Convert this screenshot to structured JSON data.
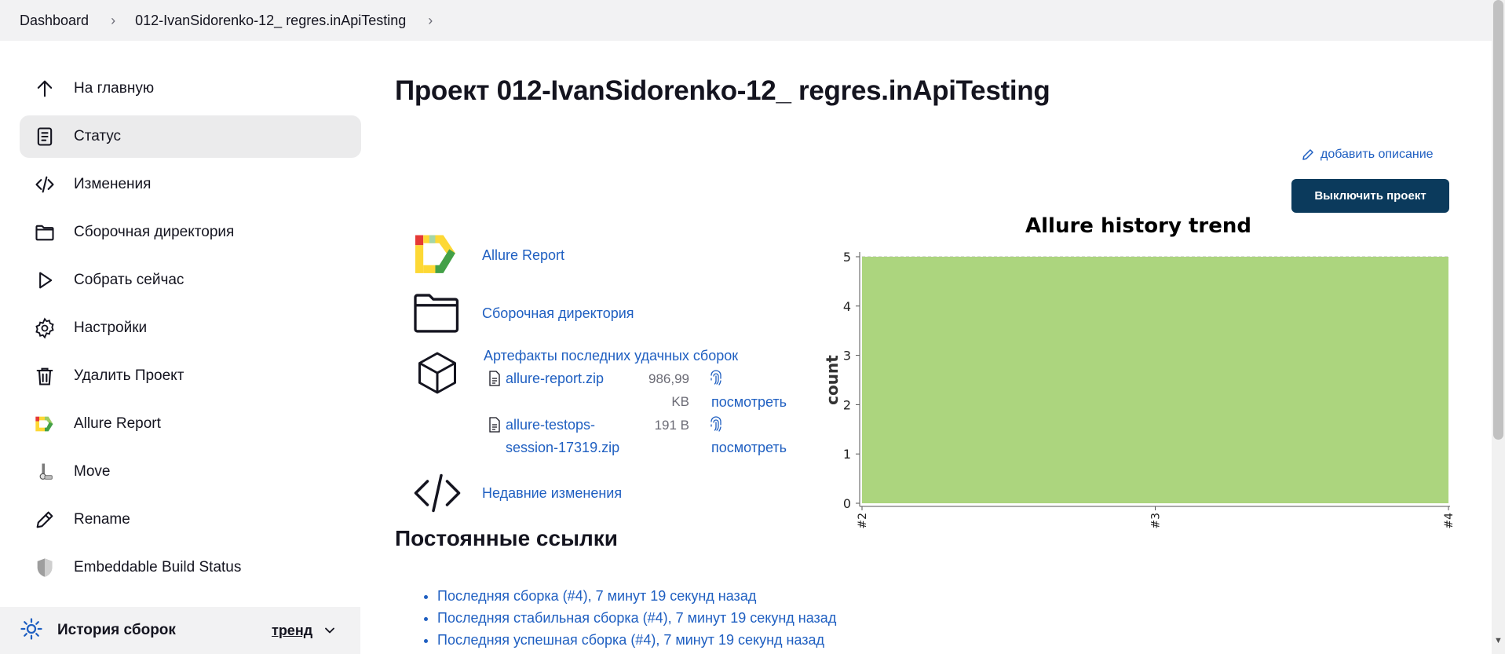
{
  "breadcrumb": {
    "items": [
      "Dashboard",
      "012-IvanSidorenko-12_ regres.inApiTesting"
    ]
  },
  "sidebar": {
    "items": [
      {
        "label": "На главную",
        "icon": "arrow-up-icon"
      },
      {
        "label": "Статус",
        "icon": "document-icon",
        "active": true
      },
      {
        "label": "Изменения",
        "icon": "code-icon"
      },
      {
        "label": "Сборочная директория",
        "icon": "folder-icon"
      },
      {
        "label": "Собрать сейчас",
        "icon": "play-icon"
      },
      {
        "label": "Настройки",
        "icon": "gear-icon"
      },
      {
        "label": "Удалить Проект",
        "icon": "trash-icon"
      },
      {
        "label": "Allure Report",
        "icon": "allure-icon"
      },
      {
        "label": "Move",
        "icon": "move-icon"
      },
      {
        "label": "Rename",
        "icon": "pencil-icon"
      },
      {
        "label": "Embeddable Build Status",
        "icon": "shield-icon"
      }
    ]
  },
  "history": {
    "title": "История сборок",
    "trend_label": "тренд"
  },
  "main": {
    "title": "Проект 012-IvanSidorenko-12_ regres.inApiTesting",
    "add_description": "добавить описание",
    "disable_button": "Выключить проект",
    "links": {
      "allure": "Allure Report",
      "workspace": "Сборочная директория",
      "artifacts_title": "Артефакты последних удачных сборок",
      "recent_changes": "Недавние изменения"
    },
    "artifacts": [
      {
        "name_line1": "allure-report.zip",
        "name_line2": "",
        "size_line1": "986,99",
        "size_line2": "KB",
        "view": "посмотреть"
      },
      {
        "name_line1": "allure-testops-",
        "name_line2": "session-17319.zip",
        "size_line1": "191 B",
        "size_line2": "",
        "view": "посмотреть"
      }
    ],
    "permalinks_title": "Постоянные ссылки",
    "permalinks": [
      "Последняя сборка (#4), 7 минут 19 секунд назад",
      "Последняя стабильная сборка (#4), 7 минут 19 секунд назад",
      "Последняя успешная сборка (#4), 7 минут 19 секунд назад"
    ]
  },
  "colors": {
    "accent": "#1f5fc1",
    "button": "#0b3a5c",
    "chart_fill": "#acd57e"
  },
  "chart_data": {
    "type": "area",
    "title": "Allure history trend",
    "ylabel": "count",
    "xlabel": "",
    "x": [
      "#2",
      "#3",
      "#4"
    ],
    "series": [
      {
        "values": [
          5,
          5,
          5
        ]
      }
    ],
    "ylim": [
      0,
      5
    ],
    "yticks": [
      0,
      1,
      2,
      3,
      4,
      5
    ],
    "grid": true
  }
}
